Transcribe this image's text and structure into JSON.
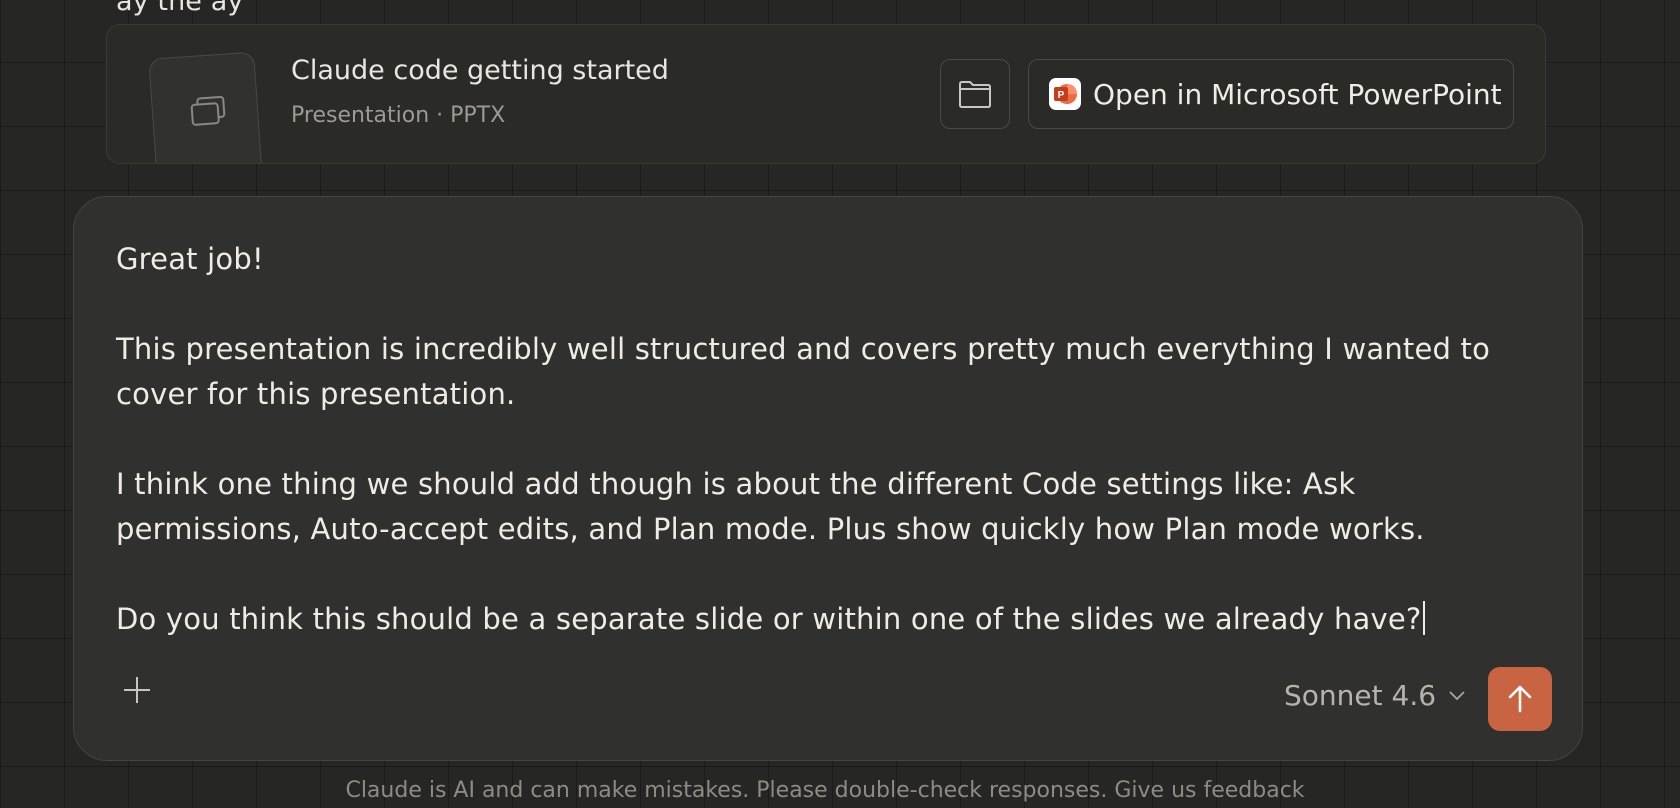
{
  "previous_message": {
    "clipped_text": "ay  the                     ay"
  },
  "file_card": {
    "title": "Claude code getting started",
    "subtitle": "Presentation · PPTX",
    "thumbnail_icon": "slides-icon",
    "folder_icon": "folder-icon",
    "open_button_label": "Open in Microsoft PowerPoint",
    "open_button_icon": "powerpoint-icon"
  },
  "composer": {
    "lines": [
      "Great job!",
      "This presentation is incredibly well structured and covers pretty much everything I wanted to",
      "cover for this presentation.",
      "I think one thing we should add though is about the different Code settings like: Ask",
      "permissions, Auto-accept edits, and Plan mode. Plus show quickly how Plan mode works.",
      "Do you think this should be a separate slide or within one of the slides we already have?"
    ],
    "add_icon": "plus-icon",
    "model_label": "Sonnet 4.6",
    "model_icon": "chevron-down-icon",
    "send_icon": "arrow-up-icon"
  },
  "footer": {
    "disclaimer": "Claude is AI and can make mistakes. Please double-check responses. Give us feedback"
  },
  "colors": {
    "background": "#262624",
    "composer": "#30302e",
    "accent": "#c96442",
    "powerpoint": "#d35230"
  }
}
